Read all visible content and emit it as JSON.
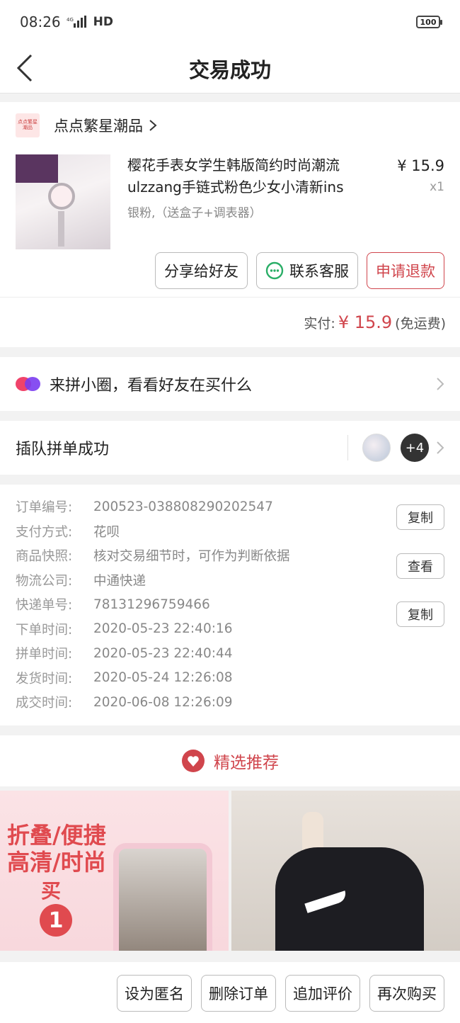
{
  "status": {
    "time": "08:26",
    "network": "HD",
    "battery": "100"
  },
  "header": {
    "title": "交易成功"
  },
  "shop": {
    "logo_text": "点点繁星潮品",
    "name": "点点繁星潮品"
  },
  "product": {
    "title_line1": "樱花手表女学生韩版简约时尚潮流",
    "title_line2": "ulzzang手链式粉色少女小清新ins",
    "spec": "银粉,（送盒子+调表器）",
    "price": "¥ 15.9",
    "qty": "x1"
  },
  "actions": {
    "share": "分享给好友",
    "contact": "联系客服",
    "refund": "申请退款"
  },
  "payment": {
    "label": "实付:",
    "currency": "¥",
    "amount": "15.9",
    "note": "(免运费)"
  },
  "circle": {
    "text": "来拼小圈，看看好友在买什么"
  },
  "group": {
    "text": "插队拼单成功",
    "more": "+4"
  },
  "order_info": {
    "rows": [
      {
        "label": "订单编号:",
        "value": "200523-038808290202547"
      },
      {
        "label": "支付方式:",
        "value": "花呗"
      },
      {
        "label": "商品快照:",
        "value": "核对交易细节时，可作为判断依据"
      },
      {
        "label": "物流公司:",
        "value": "中通快递"
      },
      {
        "label": "快递单号:",
        "value": "78131296759466"
      },
      {
        "label": "下单时间:",
        "value": "2020-05-23 22:40:16"
      },
      {
        "label": "拼单时间:",
        "value": "2020-05-23 22:40:44"
      },
      {
        "label": "发货时间:",
        "value": "2020-05-24 12:26:08"
      },
      {
        "label": "成交时间:",
        "value": "2020-06-08 12:26:09"
      }
    ],
    "copy_label": "复制",
    "view_label": "查看"
  },
  "recommend": {
    "title": "精选推荐",
    "item1": {
      "line1": "折叠/便捷",
      "line2": "高清/时尚",
      "line3": "买",
      "badge": "1"
    }
  },
  "bottom": {
    "anonymous": "设为匿名",
    "delete": "删除订单",
    "review": "追加评价",
    "rebuy": "再次购买"
  },
  "colors": {
    "accent": "#d0454c",
    "background": "#f2f2f2"
  }
}
